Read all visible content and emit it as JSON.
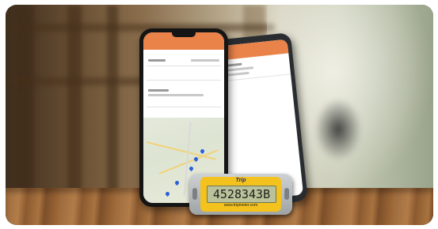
{
  "scene": {
    "description_colors": {
      "accent": "#e9834a",
      "device_body": "#f3c21d",
      "brand_text": "#1b2a7a",
      "lcd_background": "#b9c29a"
    }
  },
  "device": {
    "brand": "Trip",
    "display_reading": "4528343B",
    "website": "www.tripmeter.com"
  }
}
